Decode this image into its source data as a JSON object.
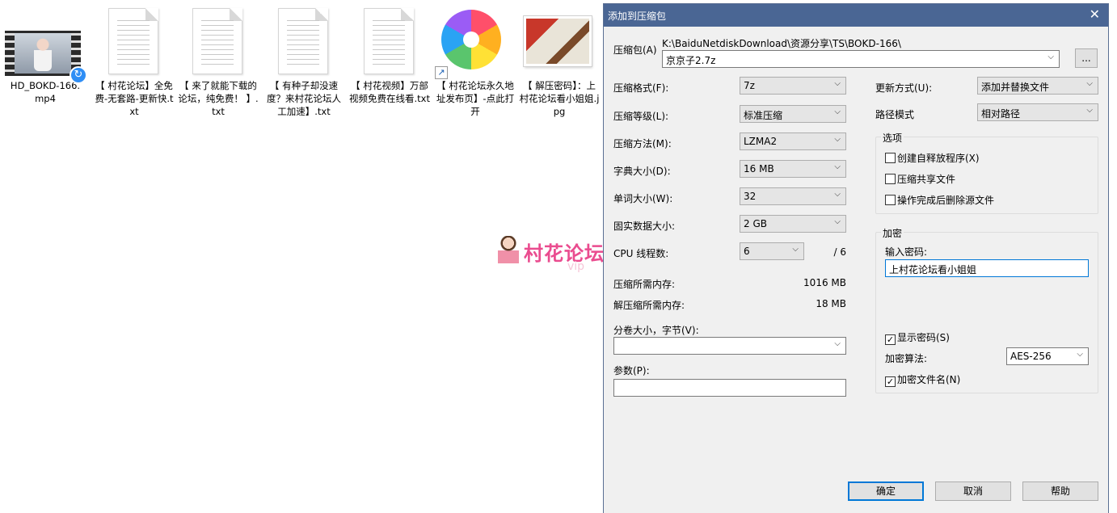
{
  "desktop": {
    "files": [
      {
        "name": "HD_BOKD-166.mp4",
        "label": "HD_BOKD-166.\nmp4"
      },
      {
        "name": "txt1",
        "label": "【 村花论坛】全免费-无套路-更新快.txt"
      },
      {
        "name": "txt2",
        "label": "【 来了就能下载的论坛，纯免费！ 】.txt"
      },
      {
        "name": "txt3",
        "label": "【 有种子却没速度？来村花论坛人工加速】.txt"
      },
      {
        "name": "txt4",
        "label": "【 村花视频】万部视频免费在线看.txt"
      },
      {
        "name": "url1",
        "label": "【 村花论坛永久地址发布页】-点此打开"
      },
      {
        "name": "jpg1",
        "label": "【 解压密码】：上村花论坛看小姐姐.jpg"
      }
    ]
  },
  "watermark": {
    "text": "村花论坛",
    "sub": "vip"
  },
  "dialog": {
    "title": "添加到压缩包",
    "close": "✕",
    "archive_label": "压缩包(A)",
    "archive_path": "K:\\BaiduNetdiskDownload\\资源分享\\TS\\BOKD-166\\",
    "archive_name": "京京子2.7z",
    "browse": "...",
    "format_label": "压缩格式(F):",
    "format_value": "7z",
    "level_label": "压缩等级(L):",
    "level_value": "标准压缩",
    "method_label": "压缩方法(M):",
    "method_value": "LZMA2",
    "dict_label": "字典大小(D):",
    "dict_value": "16 MB",
    "word_label": "单词大小(W):",
    "word_value": "32",
    "solid_label": "固实数据大小:",
    "solid_value": "2 GB",
    "cpu_label": "CPU 线程数:",
    "cpu_value": "6",
    "cpu_max": "/ 6",
    "mem_comp_label": "压缩所需内存:",
    "mem_comp_value": "1016 MB",
    "mem_decomp_label": "解压缩所需内存:",
    "mem_decomp_value": "18 MB",
    "split_label": "分卷大小，字节(V):",
    "split_value": "",
    "params_label": "参数(P):",
    "params_value": "",
    "update_label": "更新方式(U):",
    "update_value": "添加并替换文件",
    "pathmode_label": "路径模式",
    "pathmode_value": "相对路径",
    "options": {
      "title": "选项",
      "sfx": "创建自释放程序(X)",
      "shared": "压缩共享文件",
      "delete": "操作完成后删除源文件"
    },
    "encryption": {
      "title": "加密",
      "password_label": "输入密码:",
      "password_value": "上村花论坛看小姐姐",
      "show_password": "显示密码(S)",
      "method_label": "加密算法:",
      "method_value": "AES-256",
      "encrypt_names": "加密文件名(N)"
    },
    "buttons": {
      "ok": "确定",
      "cancel": "取消",
      "help": "帮助"
    },
    "check_mark": "✓",
    "dropdown_arrow": "⌵"
  }
}
